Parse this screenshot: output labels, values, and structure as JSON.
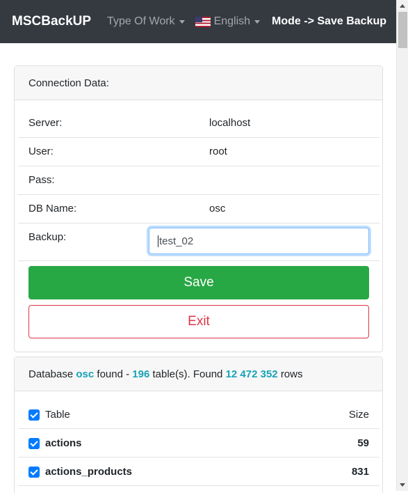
{
  "navbar": {
    "brand": "MSCBackUP",
    "type_of_work": "Type Of Work",
    "language": "English",
    "mode": "Mode -> Save Backup"
  },
  "connection": {
    "header": "Connection Data:",
    "server_label": "Server:",
    "server_value": "localhost",
    "user_label": "User:",
    "user_value": "root",
    "pass_label": "Pass:",
    "pass_value": "",
    "db_label": "DB Name:",
    "db_value": "osc",
    "backup_label": "Backup:",
    "backup_value": "test_02",
    "save_label": "Save",
    "exit_label": "Exit"
  },
  "database": {
    "prefix": "Database",
    "name": "osc",
    "found_text": "found -",
    "table_count": "196",
    "tables_text": "table(s). Found",
    "row_count": "12 472 352",
    "rows_text": "rows"
  },
  "tables": {
    "header_name": "Table",
    "header_size": "Size",
    "rows": [
      {
        "name": "actions",
        "size": "59"
      },
      {
        "name": "actions_products",
        "size": "831"
      }
    ]
  },
  "colors": {
    "navbar": "#343a40",
    "success": "#28a745",
    "danger": "#dc3545",
    "info": "#17a2b8",
    "checkbox": "#007bff"
  }
}
